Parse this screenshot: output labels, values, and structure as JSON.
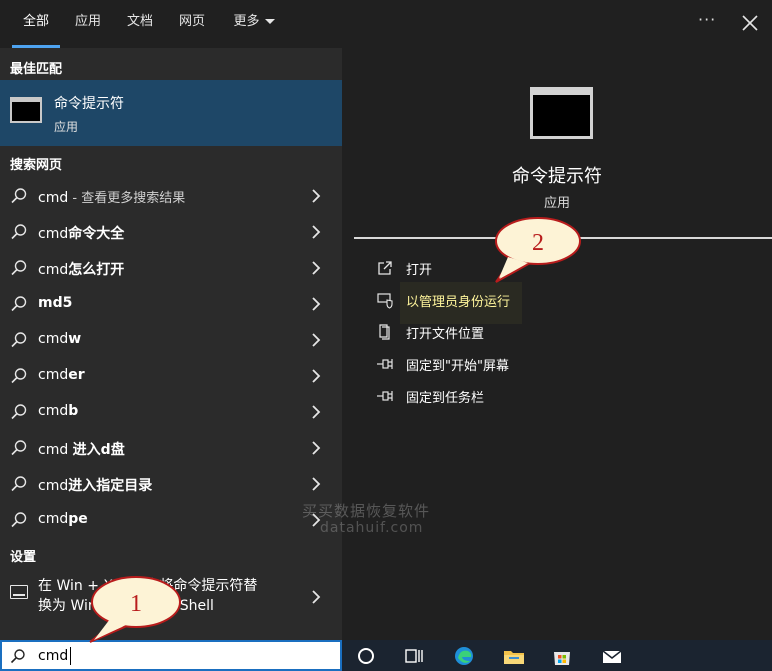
{
  "tabs": [
    {
      "label": "全部",
      "active": true
    },
    {
      "label": "应用",
      "active": false
    },
    {
      "label": "文档",
      "active": false
    },
    {
      "label": "网页",
      "active": false
    },
    {
      "label": "更多",
      "active": false
    }
  ],
  "window_controls": {
    "more_glyph": "···",
    "close": "close-icon"
  },
  "left": {
    "best_match_title": "最佳匹配",
    "best_match": {
      "name": "命令提示符",
      "type": "应用"
    },
    "web_title": "搜索网页",
    "results": [
      {
        "prefix": "cmd",
        "highlight": "",
        "desc": " - 查看更多搜索结果"
      },
      {
        "prefix": "cmd",
        "highlight": "命令大全",
        "desc": ""
      },
      {
        "prefix": "cmd",
        "highlight": "怎么打开",
        "desc": ""
      },
      {
        "prefix": "",
        "highlight": "md5",
        "desc": ""
      },
      {
        "prefix": "cmd",
        "highlight": "w",
        "desc": ""
      },
      {
        "prefix": "cmd",
        "highlight": "er",
        "desc": ""
      },
      {
        "prefix": "cmd",
        "highlight": "b",
        "desc": ""
      },
      {
        "prefix": "cmd ",
        "highlight": "进入d盘",
        "desc": ""
      },
      {
        "prefix": "cmd",
        "highlight": "进入指定目录",
        "desc": ""
      },
      {
        "prefix": "cmd",
        "highlight": "pe",
        "desc": ""
      }
    ],
    "settings_title": "设置",
    "setting_item": {
      "line1": "在 Win + X 菜单中将命令提示符替",
      "line2": "换为 Windows PowerShell"
    }
  },
  "right": {
    "app_title": "命令提示符",
    "app_type": "应用",
    "actions": [
      {
        "label": "打开",
        "icon": "open-icon"
      },
      {
        "label": "以管理员身份运行",
        "icon": "shield-icon"
      },
      {
        "label": "打开文件位置",
        "icon": "file-location-icon"
      },
      {
        "label": "固定到\"开始\"屏幕",
        "icon": "pin-icon"
      },
      {
        "label": "固定到任务栏",
        "icon": "pin-icon"
      }
    ],
    "watermark": {
      "line1": "买买数据恢复软件",
      "line2": "datahuif.com"
    }
  },
  "search": {
    "value": "cmd"
  },
  "callouts": {
    "one": "1",
    "two": "2"
  },
  "colors": {
    "accent": "#4ea3f0",
    "best_match_bg": "#1e4767",
    "highlight_text": "#fff59c",
    "callout_border": "#b81c1c",
    "callout_fill": "#fdf3d6"
  }
}
